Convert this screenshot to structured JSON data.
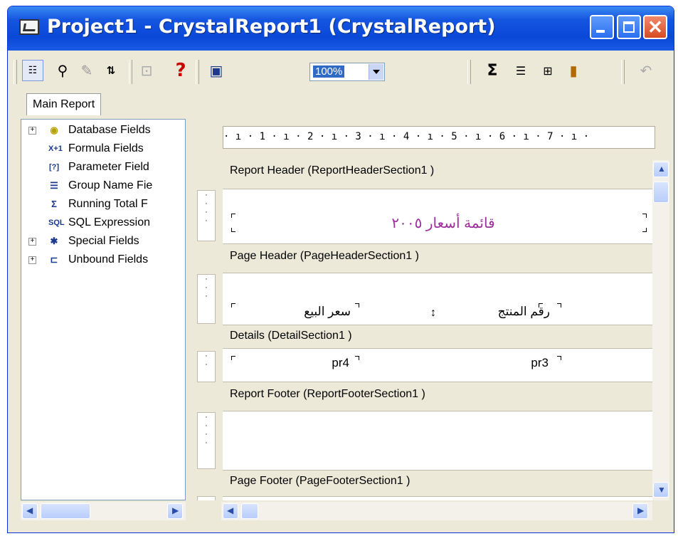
{
  "window": {
    "title": "Project1 - CrystalReport1 (CrystalReport)"
  },
  "toolbar": {
    "zoom": "100%",
    "sigma": "Σ",
    "help": "?"
  },
  "tabs": {
    "main": "Main Report"
  },
  "tree": {
    "items": [
      {
        "label": "Database Fields",
        "icon": "database-icon",
        "expandable": true
      },
      {
        "label": "Formula Fields",
        "icon": "formula-icon",
        "icon_text": "X+1",
        "expandable": false
      },
      {
        "label": "Parameter Field",
        "icon": "parameter-icon",
        "icon_text": "[?]",
        "expandable": false
      },
      {
        "label": "Group Name Fie",
        "icon": "group-icon",
        "expandable": false
      },
      {
        "label": "Running Total F",
        "icon": "sigma-icon",
        "expandable": false
      },
      {
        "label": "SQL Expression",
        "icon": "sql-icon",
        "icon_text": "SQL",
        "expandable": false
      },
      {
        "label": "Special Fields",
        "icon": "special-fields-icon",
        "expandable": true
      },
      {
        "label": "Unbound Fields",
        "icon": "unbound-icon",
        "expandable": true
      }
    ]
  },
  "ruler": {
    "text": "· ı · 1 · ı · 2 · ı · 3 · ı · 4 · ı · 5 · ı · 6 · ı · 7 · ı ·"
  },
  "sections": {
    "report_header": {
      "label": "Report Header  (ReportHeaderSection1 )",
      "title_text": "قائمة أسعار ٢٠٠٥"
    },
    "page_header": {
      "label": "Page Header  (PageHeaderSection1 )",
      "col1": "سعر البيع",
      "col2": "رقم المنتج"
    },
    "details": {
      "label": "Details  (DetailSection1 )",
      "field1": "pr4",
      "field2": "pr3"
    },
    "report_footer": {
      "label": "Report Footer  (ReportFooterSection1 )"
    },
    "page_footer": {
      "label": "Page Footer  (PageFooterSection1 )"
    }
  },
  "colors": {
    "title_bar": "#0a48d8",
    "arabic_title": "#9b2f9b",
    "chrome": "#ece9d8"
  }
}
